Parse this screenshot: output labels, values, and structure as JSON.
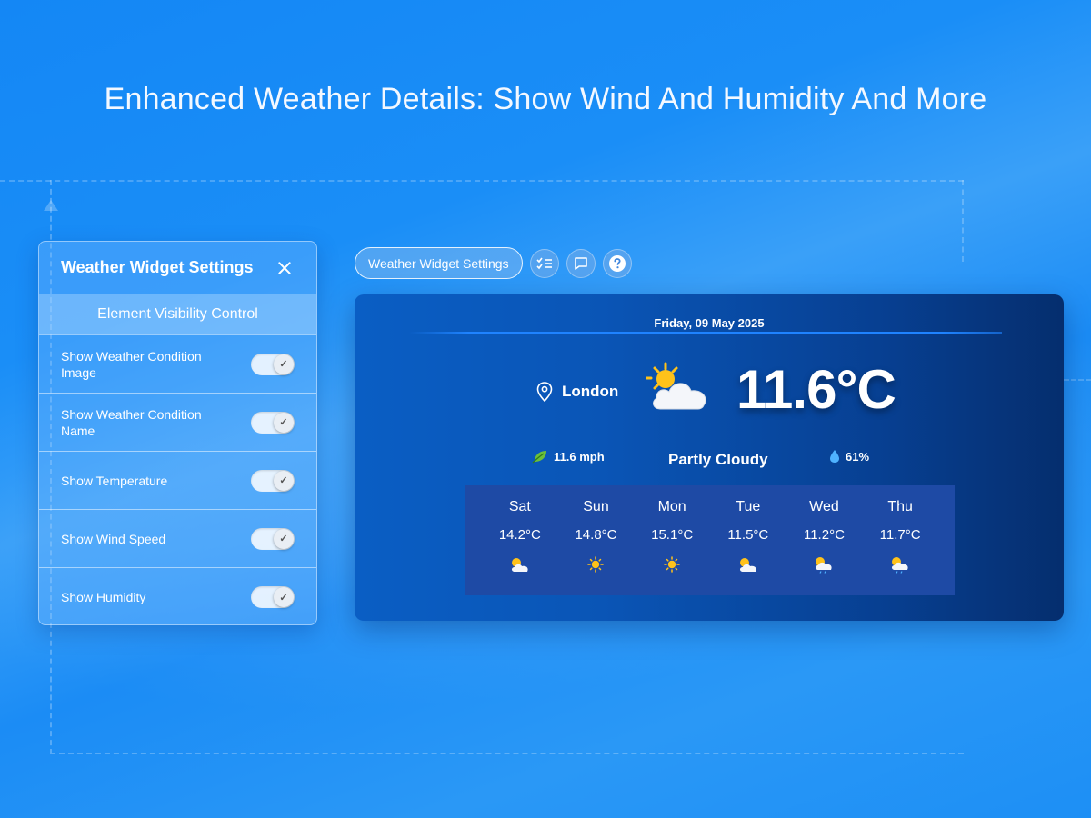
{
  "headline": "Enhanced Weather Details: Show Wind And Humidity And More",
  "settings_panel": {
    "title": "Weather Widget Settings",
    "section": "Element Visibility Control",
    "rows": [
      {
        "label": "Show Weather Condition Image",
        "enabled": true
      },
      {
        "label": "Show Weather Condition Name",
        "enabled": true
      },
      {
        "label": "Show Temperature",
        "enabled": true
      },
      {
        "label": "Show Wind Speed",
        "enabled": true
      },
      {
        "label": "Show Humidity",
        "enabled": true
      }
    ],
    "toggle_check": "✓"
  },
  "toolbar": {
    "settings_label": "Weather Widget Settings",
    "icons": [
      "checklist-icon",
      "comment-icon",
      "help-icon"
    ]
  },
  "weather": {
    "date": "Friday, 09 May 2025",
    "location": "London",
    "temperature": "11.6°C",
    "wind": "11.6 mph",
    "condition": "Partly Cloudy",
    "humidity": "61%",
    "forecast": [
      {
        "day": "Sat",
        "temp": "14.2°C",
        "icon": "partly-cloudy"
      },
      {
        "day": "Sun",
        "temp": "14.8°C",
        "icon": "sunny"
      },
      {
        "day": "Mon",
        "temp": "15.1°C",
        "icon": "sunny"
      },
      {
        "day": "Tue",
        "temp": "11.5°C",
        "icon": "partly-cloudy"
      },
      {
        "day": "Wed",
        "temp": "11.2°C",
        "icon": "partly-cloudy-rain"
      },
      {
        "day": "Thu",
        "temp": "11.7°C",
        "icon": "partly-cloudy-rain"
      }
    ]
  },
  "colors": {
    "background": "#1a8cf5",
    "card_start": "#0a5ec4",
    "card_end": "#052e6e",
    "forecast_bg": "#1e4aa5",
    "sun": "#ffc21a"
  }
}
